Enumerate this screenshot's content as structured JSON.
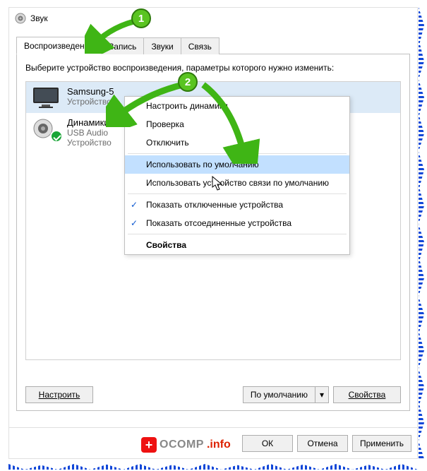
{
  "window": {
    "title": "Звук"
  },
  "tabs": [
    {
      "label": "Воспроизведение",
      "active": true
    },
    {
      "label": "Запись"
    },
    {
      "label": "Звуки"
    },
    {
      "label": "Связь"
    }
  ],
  "instruction": "Выберите устройство воспроизведения, параметры которого нужно изменить:",
  "devices": [
    {
      "name": "Samsung-5",
      "sub1": "Устройство"
    },
    {
      "name": "Динамики",
      "sub1": "USB Audio",
      "sub2": "Устройство"
    }
  ],
  "context_menu": {
    "items": [
      {
        "label": "Настроить динамики"
      },
      {
        "label": "Проверка"
      },
      {
        "label": "Отключить"
      },
      {
        "sep": true
      },
      {
        "label": "Использовать по умолчанию",
        "highlight": true
      },
      {
        "label": "Использовать устройство связи по умолчанию"
      },
      {
        "sep": true
      },
      {
        "label": "Показать отключенные устройства",
        "checked": true
      },
      {
        "label": "Показать отсоединенные устройства",
        "checked": true
      },
      {
        "sep": true
      },
      {
        "label": "Свойства",
        "bold": true
      }
    ]
  },
  "buttons": {
    "configure": "Настроить",
    "set_default": "По умолчанию",
    "properties": "Свойства",
    "ok": "ОК",
    "cancel": "Отмена",
    "apply": "Применить"
  },
  "annotations": {
    "b1": "1",
    "b2": "2"
  },
  "watermark": {
    "brand": "OCOMP",
    "suffix": ".info"
  }
}
